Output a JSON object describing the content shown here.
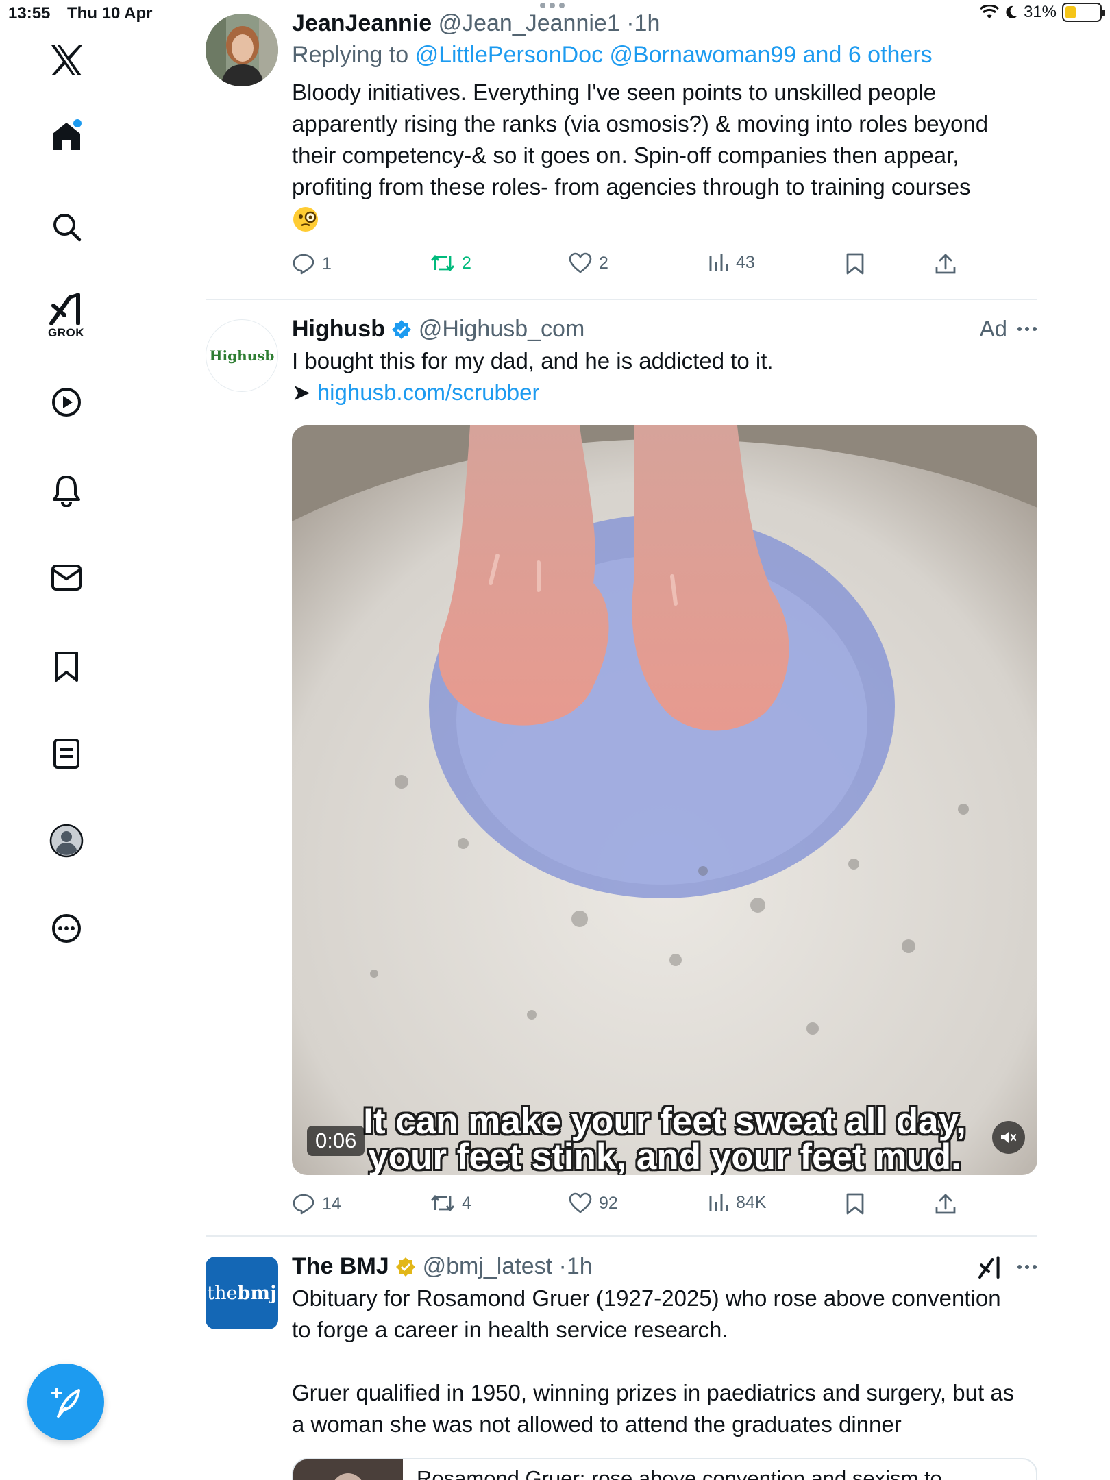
{
  "status_bar": {
    "time": "13:55",
    "date": "Thu 10 Apr",
    "battery_text": "31%",
    "battery_level": 0.31,
    "battery_color": "#f5c518"
  },
  "sidebar": {
    "items": [
      {
        "icon": "x-logo-icon"
      },
      {
        "icon": "home-icon",
        "has_notification_dot": true
      },
      {
        "icon": "search-icon"
      },
      {
        "icon": "grok-icon",
        "label": "GROK"
      },
      {
        "icon": "video-play-icon"
      },
      {
        "icon": "notifications-bell-icon"
      },
      {
        "icon": "messages-envelope-icon"
      },
      {
        "icon": "bookmarks-icon"
      },
      {
        "icon": "lists-icon"
      },
      {
        "icon": "profile-icon"
      },
      {
        "icon": "more-icon"
      }
    ],
    "compose_icon": "compose-post-icon"
  },
  "accent_color": "#1d9bf0",
  "retweet_color": "#00ba7c",
  "posts": [
    {
      "author": "JeanJeannie",
      "handle": "@Jean_Jeannie1",
      "dot": "·",
      "time": "1h",
      "replying_prefix": "Replying to",
      "replying_to": "@LittlePersonDoc @Bornawoman99 and 6 others",
      "text_lines": [
        "Bloody initiatives. Everything I've seen points to unskilled people",
        "apparently rising the ranks (via osmosis?) & moving into roles beyond",
        "their competency-& so it goes on. Spin-off companies then appear,",
        "profiting from these roles- from agencies through to training courses"
      ],
      "emoji": "🧐",
      "replies": "1",
      "reposts": "2",
      "likes": "2",
      "views": "43"
    },
    {
      "author": "Highusb",
      "handle": "@Highusb_com",
      "verified": true,
      "ad_label": "Ad",
      "avatar_text": "Highusb",
      "text": "I bought this for my dad, and he is addicted to it.",
      "arrow": "➤",
      "link": "highusb.com/scrubber",
      "video": {
        "duration": "0:06",
        "caption_line1": "It can make your feet sweat all day,",
        "caption_line2": "your feet stink, and your feet mud.",
        "muted": true
      },
      "replies": "14",
      "reposts": "4",
      "likes": "92",
      "views": "84K"
    },
    {
      "author": "The BMJ",
      "handle": "@bmj_latest",
      "dot": "·",
      "time": "1h",
      "verified_gold": true,
      "avatar_text_1": "the",
      "avatar_text_2": "bmj",
      "avatar_color": "#1467b5",
      "text_lines_1": [
        "Obituary for Rosamond Gruer (1927-2025) who rose above convention",
        "to forge a career in health service research."
      ],
      "text_lines_2": [
        "Gruer qualified in 1950, winning prizes in paediatrics and surgery, but as",
        "a woman she was not allowed to attend the graduates dinner"
      ],
      "card_title": "Rosamond Gruer: rose above convention and sexism to"
    }
  ]
}
